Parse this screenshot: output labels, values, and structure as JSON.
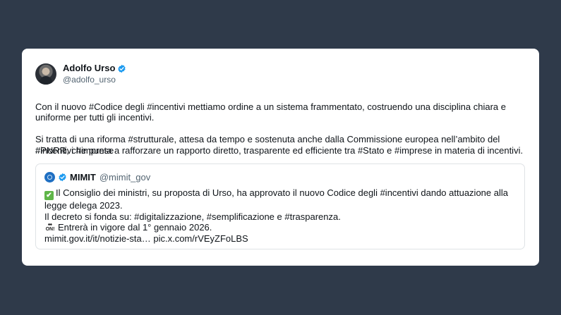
{
  "tweet": {
    "author": {
      "display_name": "Adolfo Urso",
      "handle": "@adolfo_urso",
      "verified": true,
      "avatar_icon": "avatar-photo"
    },
    "text_lines": [
      "Con il nuovo #Codice degli #incentivi mettiamo ordine a un sistema frammentato, costruendo una disciplina chiara e uniforme per tutti gli incentivi.",
      "Si tratta di una riforma #strutturale, attesa da tempo e sostenuta anche dalla Commissione europea nell’ambito del #PNRR, che punta a rafforzare un rapporto diretto, trasparente ed efficiente tra #Stato e #imprese in materia di incentivi."
    ],
    "hashtags_line": "#incentivi #imprese"
  },
  "quoted": {
    "display_name": "MIMIT",
    "handle": "@mimit_gov",
    "verified": true,
    "logo_icon": "mimit-logo-icon",
    "line1": "Il Consiglio dei ministri, su proposta di Urso, ha approvato il nuovo Codice degli #incentivi dando attuazione alla legge delega 2023.",
    "line2": "Il decreto si fonda su: #digitalizzazione, #semplificazione e #trasparenza.",
    "line3": "Entrerà in vigore dal 1° gennaio 2026.",
    "line4": "mimit.gov.it/it/notizie-sta… pic.x.com/rVEyZFoLBS",
    "check_emoji": "✔",
    "on_arrow": "⬌",
    "on_text": "ON!"
  },
  "colors": {
    "background": "#2f3a4a",
    "card": "#ffffff",
    "verified_blue": "#1d9bf0",
    "muted": "#536471"
  }
}
